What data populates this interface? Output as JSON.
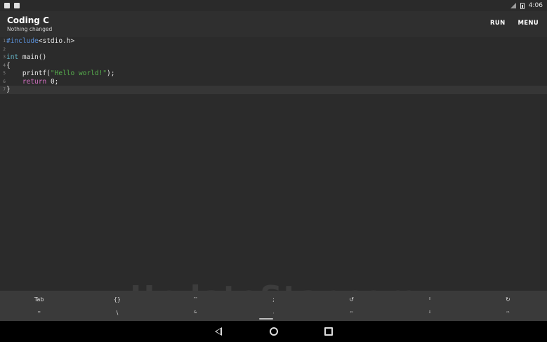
{
  "status_bar": {
    "time": "4:06",
    "left_icons": [
      "notification-icon",
      "android-icon"
    ],
    "right_icons": [
      "signal-icon",
      "battery-icon"
    ]
  },
  "app_bar": {
    "title": "Coding C",
    "subtitle": "Nothing changed",
    "actions": [
      {
        "label": "RUN"
      },
      {
        "label": "MENU"
      }
    ]
  },
  "editor": {
    "lines": [
      {
        "number": "1",
        "parts": [
          {
            "t": "#include",
            "c": "kw-pre"
          },
          {
            "t": "<stdio.h>",
            "c": ""
          }
        ]
      },
      {
        "number": "2",
        "parts": []
      },
      {
        "number": "3",
        "parts": [
          {
            "t": "int",
            "c": "kw-type"
          },
          {
            "t": " main()",
            "c": ""
          }
        ]
      },
      {
        "number": "4",
        "parts": [
          {
            "t": "{",
            "c": ""
          }
        ]
      },
      {
        "number": "5",
        "parts": [
          {
            "t": "    printf(",
            "c": ""
          },
          {
            "t": "\"Hello world!\"",
            "c": "str"
          },
          {
            "t": ");",
            "c": ""
          }
        ]
      },
      {
        "number": "6",
        "parts": [
          {
            "t": "    ",
            "c": ""
          },
          {
            "t": "return",
            "c": "kw-ret"
          },
          {
            "t": " 0;",
            "c": ""
          }
        ]
      },
      {
        "number": "7",
        "parts": [
          {
            "t": "}",
            "c": ""
          }
        ]
      }
    ],
    "active_line": 7
  },
  "keybar": {
    "row1": [
      {
        "label": "Tab",
        "small": false
      },
      {
        "label": "{}",
        "small": false
      },
      {
        "label": "\"\"",
        "small": true
      },
      {
        "label": ";",
        "small": false
      },
      {
        "label": "↺",
        "small": false
      },
      {
        "label": "⇧",
        "small": true
      },
      {
        "label": "↻",
        "small": false
      }
    ],
    "row2": [
      {
        "label": "=",
        "small": true
      },
      {
        "label": "\\",
        "small": false
      },
      {
        "label": "&",
        "small": true
      },
      {
        "label": ",",
        "small": true
      },
      {
        "label": "⇦",
        "small": true
      },
      {
        "label": "⇩",
        "small": true
      },
      {
        "label": "⇨",
        "small": true
      }
    ]
  },
  "watermark": "UpdateStar.com"
}
